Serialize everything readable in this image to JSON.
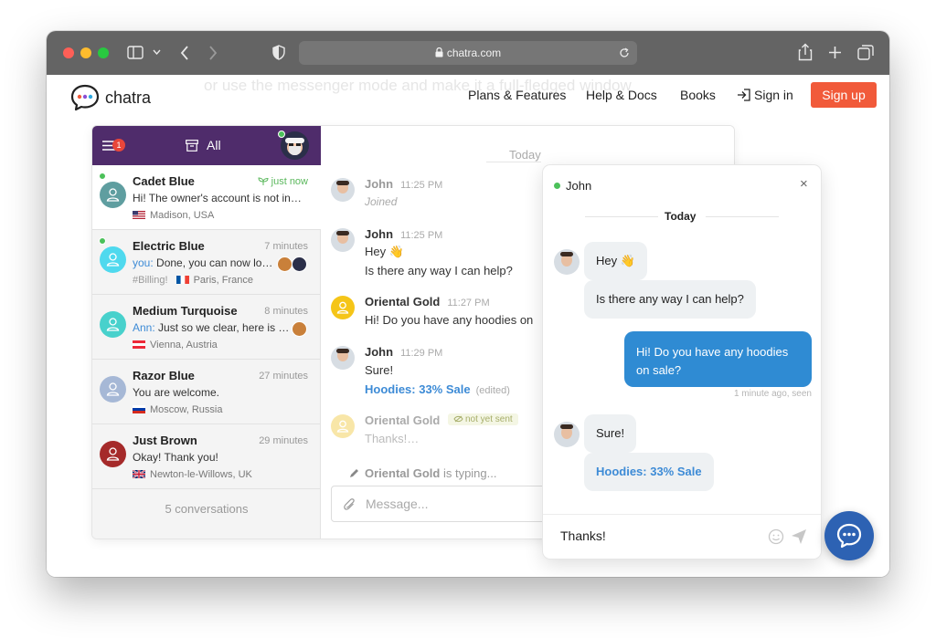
{
  "browser": {
    "url": "chatra.com"
  },
  "site": {
    "logo_text": "chatra",
    "ghost_text": "or use the messenger mode and make it a full-fledged window",
    "nav": [
      "Plans & Features",
      "Help & Docs",
      "Books",
      "Sign in"
    ],
    "signup": "Sign up"
  },
  "app": {
    "badge": "1",
    "filter": "All",
    "conversations": [
      {
        "name": "Cadet Blue",
        "time": "just now",
        "preview": "Hi! The owner's account is not in…",
        "location": "Madison, USA",
        "color": "#5f9ea0"
      },
      {
        "name": "Electric Blue",
        "time": "7 minutes",
        "preview_prefix": "you:",
        "preview": " Done, you can now lo…",
        "tag": "#Billing!",
        "location": "Paris, France",
        "color": "#4fd9ee"
      },
      {
        "name": "Medium Turquoise",
        "time": "8 minutes",
        "preview_prefix": "Ann:",
        "preview": " Just so we clear, here is …",
        "location": "Vienna, Austria",
        "color": "#48d1cc"
      },
      {
        "name": "Razor Blue",
        "time": "27 minutes",
        "preview": "You are welcome.",
        "location": "Moscow, Russia",
        "color": "#a6b8d6"
      },
      {
        "name": "Just Brown",
        "time": "29 minutes",
        "preview": "Okay! Thank you!",
        "location": "Newton-le-Willows, UK",
        "color": "#a52a2a"
      }
    ],
    "count_label": "5 conversations",
    "chat": {
      "date": "Today",
      "messages": [
        {
          "author": "John",
          "time": "11:25 PM",
          "text": "Joined"
        },
        {
          "author": "John",
          "time": "11:25 PM",
          "text": "Hey 👋",
          "text2": "Is there any way I can help?"
        },
        {
          "author": "Oriental Gold",
          "time": "11:27 PM",
          "text": "Hi! Do you have any hoodies on"
        },
        {
          "author": "John",
          "time": "11:29 PM",
          "text": "Sure!",
          "link": "Hoodies: 33% Sale",
          "edited": "(edited)"
        },
        {
          "author": "Oriental Gold",
          "status": "not yet sent",
          "text": "Thanks!…"
        }
      ],
      "typing_name": "Oriental Gold",
      "typing_suffix": " is typing...",
      "input_placeholder": "Message..."
    }
  },
  "widget": {
    "agent": "John",
    "close": "×",
    "date": "Today",
    "bubbles": {
      "hey": "Hey 👋",
      "help": "Is there any way I can help?",
      "visitor_line1": "Hi! Do you have any hoodies",
      "visitor_line2": "on sale?",
      "meta": "1 minute ago, seen",
      "sure": "Sure!",
      "link": "Hoodies: 33% Sale"
    },
    "input_value": "Thanks!"
  },
  "colors": {
    "header": "#4f2c6b",
    "accent": "#f15a3a",
    "link": "#3d8bd6",
    "visitor_bubble": "#2f8bd3",
    "fab": "#2d62b3"
  }
}
